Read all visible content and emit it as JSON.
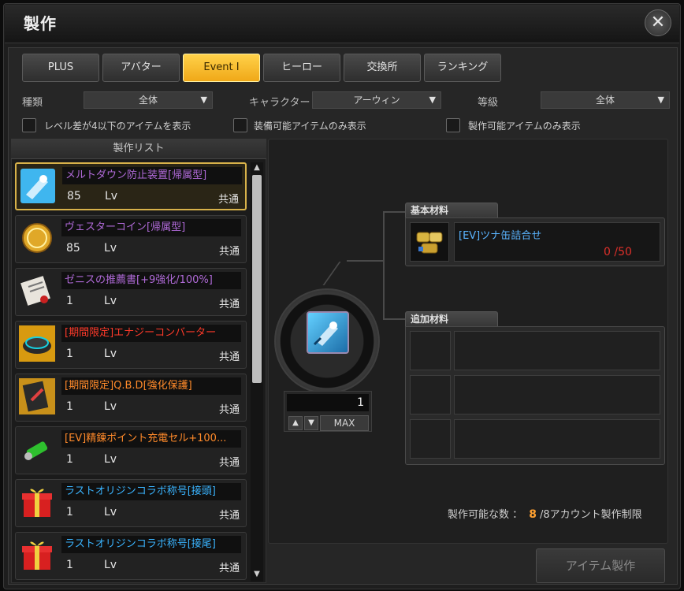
{
  "window": {
    "title": "製作",
    "close_symbol": "✕"
  },
  "tabs": [
    {
      "label": "PLUS",
      "active": false
    },
    {
      "label": "アバター",
      "active": false
    },
    {
      "label": "Event Ⅰ",
      "active": true
    },
    {
      "label": "ヒーロー",
      "active": false
    },
    {
      "label": "交換所",
      "active": false
    },
    {
      "label": "ランキング",
      "active": false
    }
  ],
  "filters": {
    "type_label": "種類",
    "type_value": "全体",
    "character_label": "キャラクター",
    "character_value": "アーウィン",
    "grade_label": "等級",
    "grade_value": "全体",
    "arrow": "▼"
  },
  "checkboxes": [
    {
      "label": "レベル差が4以下のアイテムを表示",
      "checked": false
    },
    {
      "label": "装備可能アイテムのみ表示",
      "checked": false
    },
    {
      "label": "製作可能アイテムのみ表示",
      "checked": false
    }
  ],
  "craft_list": {
    "header": "製作リスト",
    "lv_unit": "Lv",
    "items": [
      {
        "name": "メルトダウン防止装置[帰属型]",
        "level": "85",
        "share": "共通",
        "name_color": "#b06ad8",
        "icon": "meltdown-device-icon"
      },
      {
        "name": "ヴェスターコイン[帰属型]",
        "level": "85",
        "share": "共通",
        "name_color": "#b06ad8",
        "icon": "gold-coin-icon"
      },
      {
        "name": "ゼニスの推薦書[+9強化/100%]",
        "level": "1",
        "share": "共通",
        "name_color": "#b06ad8",
        "icon": "recommendation-letter-icon"
      },
      {
        "name": "[期間限定]エナジーコンバーター",
        "level": "1",
        "share": "共通",
        "name_color": "#ff3a2a",
        "icon": "energy-converter-icon"
      },
      {
        "name": "[期間限定]Q.B.D[強化保護]",
        "level": "1",
        "share": "共通",
        "name_color": "#ff8a2a",
        "icon": "qbd-card-icon"
      },
      {
        "name": "[EV]精錬ポイント充電セル+100...",
        "level": "1",
        "share": "共通",
        "name_color": "#ff8a2a",
        "icon": "charge-cell-icon"
      },
      {
        "name": "ラストオリジンコラボ称号[接頭]",
        "level": "1",
        "share": "共通",
        "name_color": "#3ab4ff",
        "icon": "gift-box-icon"
      },
      {
        "name": "ラストオリジンコラボ称号[接尾]",
        "level": "1",
        "share": "共通",
        "name_color": "#3ab4ff",
        "icon": "gift-box-icon"
      }
    ]
  },
  "quantity": {
    "value": "1",
    "up": "▲",
    "down": "▼",
    "max_label": "MAX"
  },
  "materials": {
    "basic_label": "基本材料",
    "basic_item": {
      "name": "[EV]ツナ缶詰合せ",
      "count": "0 /50",
      "icon": "tuna-can-set-icon"
    },
    "extra_label": "追加材料"
  },
  "craftable": {
    "label": "製作可能な数 ：",
    "count": "8",
    "limit": "/8アカウント製作制限"
  },
  "craft_button": "アイテム製作",
  "colors": {
    "accent": "#f0b420",
    "count_red": "#e0302a",
    "count_orange": "#ffa030"
  }
}
